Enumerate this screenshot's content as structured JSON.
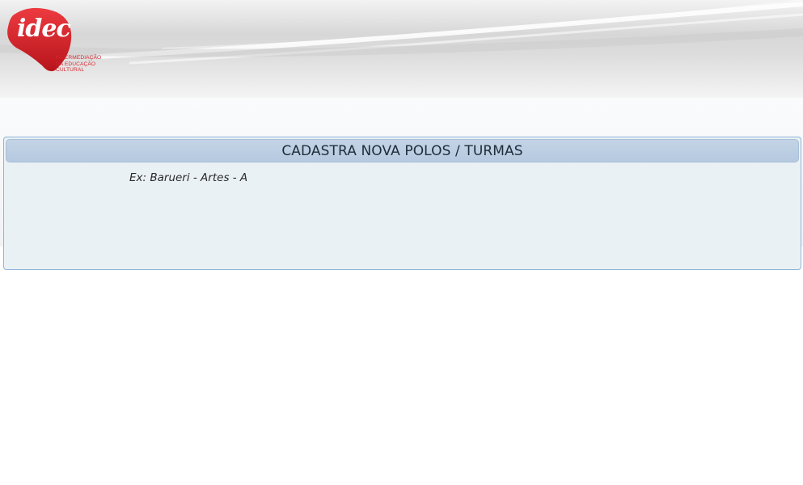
{
  "brand": {
    "logo_word": "idec",
    "logo_tagline_lines": [
      "INTERMEDIAÇÃO",
      "DA EDUCAÇÃO",
      "CULTURAL"
    ],
    "logo_color": "#d7262e"
  },
  "form": {
    "title": "CADASTRA NOVA POLOS / TURMAS",
    "hint": "Ex: Barueri - Artes - A"
  },
  "colors": {
    "panel_background": "#eaf1f5",
    "panel_border": "#8fb4d8",
    "title_bar": "#b6c9df"
  }
}
